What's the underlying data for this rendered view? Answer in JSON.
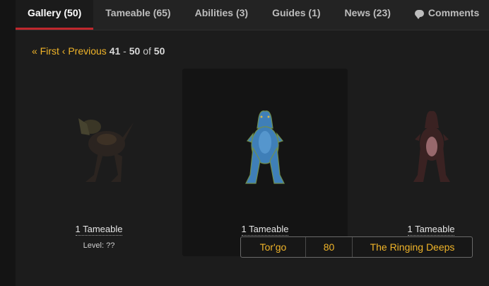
{
  "tabs": [
    {
      "label": "Gallery (50)",
      "active": true
    },
    {
      "label": "Tameable (65)",
      "active": false
    },
    {
      "label": "Abilities (3)",
      "active": false
    },
    {
      "label": "Guides (1)",
      "active": false
    },
    {
      "label": "News (23)",
      "active": false
    },
    {
      "label": "Comments",
      "icon": "comment-icon",
      "active": false
    }
  ],
  "pager": {
    "first": "« First",
    "previous": "‹ Previous",
    "range_start": "41",
    "separator": "-",
    "range_end": "50",
    "of": "of",
    "total": "50"
  },
  "gallery": [
    {
      "tameable": "1 Tameable",
      "level": "Level: ??",
      "model_icon": "dark-green-dinosaur-icon"
    },
    {
      "tameable": "1 Tameable",
      "level": "",
      "model_icon": "blue-dinosaur-icon"
    },
    {
      "tameable": "1 Tameable",
      "level": "",
      "model_icon": "dark-red-dinosaur-icon"
    }
  ],
  "tooltip": {
    "name": "Tor'go",
    "level": "80",
    "zone": "The Ringing Deeps"
  },
  "colors": {
    "accent_link": "#f0b429",
    "active_tab_underline": "#c0282d",
    "background": "#1c1c1c"
  }
}
